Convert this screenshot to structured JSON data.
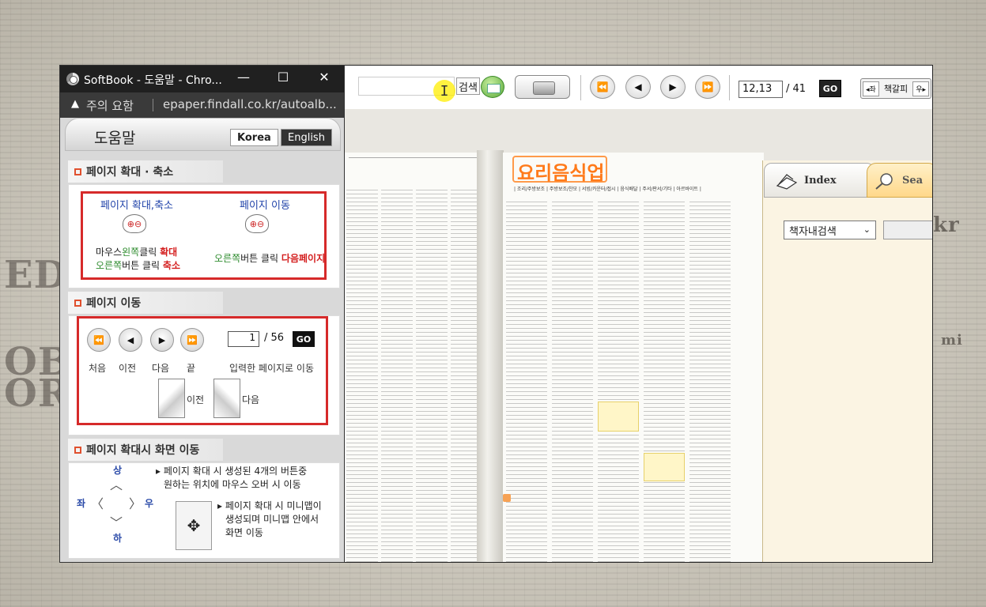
{
  "popup": {
    "title": "SoftBook - 도움말 - Chro...",
    "win_minimize": "—",
    "win_maximize": "☐",
    "win_close": "✕",
    "warning_icon": "▲",
    "warning_text": "주의 요함",
    "url": "epaper.findall.co.kr/autoalb...",
    "help_title": "도움말",
    "lang_korea": "Korea",
    "lang_english": "English",
    "zoom_section": {
      "title": "페이지 확대 · 축소",
      "left_title": "페이지 확대,축소",
      "right_title": "페이지 이동",
      "left_line1_pre": "마우스",
      "left_line1_mid": "왼쪽",
      "left_line1_post": "클릭 ",
      "left_line1_action": "확대",
      "left_line2_pre": "오른쪽",
      "left_line2_post": "버튼 클릭 ",
      "left_line2_action": "축소",
      "right_line_pre": "오른쪽",
      "right_line_post": "버튼 클릭 ",
      "right_line_action": "다음페이지"
    },
    "move_section": {
      "title": "페이지 이동",
      "page_input": "1",
      "page_total": "/ 56",
      "go": "GO",
      "label_first": "처음",
      "label_prev": "이전",
      "label_next": "다음",
      "label_last": "끝",
      "label_input": "입력한 페이지로 이동",
      "curl_prev": "이전",
      "curl_next": "다음"
    },
    "screen_section": {
      "title": "페이지 확대시 화면 이동",
      "dir_up": "상",
      "dir_left": "좌",
      "dir_right": "우",
      "dir_down": "하",
      "desc1_line1": "▸ 페이지 확대 시 생성된 4개의 버튼중",
      "desc1_line2": "원하는 위치에 마우스 오버 시 이동",
      "desc2_line1": "▸ 페이지 확대 시 미니맵이",
      "desc2_line2": "생성되며 미니맵 안에서",
      "desc2_line3": "화면 이동"
    }
  },
  "toolbar": {
    "search_button": "검색",
    "page_current": "12,13",
    "page_total": "/ 41",
    "go": "GO",
    "bookmark_left": "◂좌",
    "bookmark_label": "책갈피",
    "bookmark_right": "우▸"
  },
  "magazine": {
    "title": "요리음식업",
    "subcats": "| 조리/주방보조 | 주방보조/찬모 | 서빙/카운터/접시 | 음식배달 | 주서/판서/기타 | 아르바이트 |"
  },
  "side_panel": {
    "tab_index": "Index",
    "tab_search": "Sea",
    "select_value": "책자내검색",
    "select_arrow": "⌄"
  },
  "icons": {
    "first": "⏪",
    "prev": "◀",
    "next": "▶",
    "last": "⏩",
    "move": "✥"
  }
}
